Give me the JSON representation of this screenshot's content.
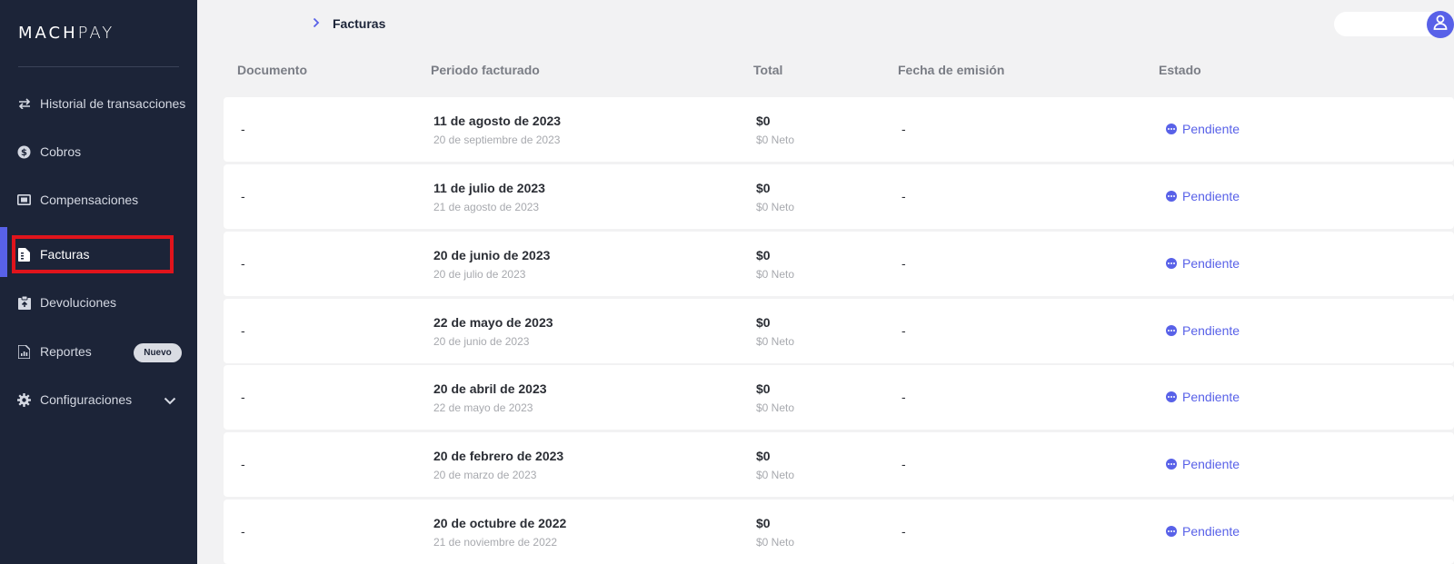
{
  "app": {
    "logo_bold": "MACH",
    "logo_light": "PAY"
  },
  "sidebar": {
    "items": [
      {
        "label": "Historial de transacciones",
        "icon": "arrows-swap-icon"
      },
      {
        "label": "Cobros",
        "icon": "dollar-coin-icon"
      },
      {
        "label": "Compensaciones",
        "icon": "banknote-icon"
      },
      {
        "label": "Facturas",
        "icon": "invoice-icon",
        "active": true
      },
      {
        "label": "Devoluciones",
        "icon": "return-box-icon"
      },
      {
        "label": "Reportes",
        "icon": "report-chart-icon",
        "badge": "Nuevo"
      },
      {
        "label": "Configuraciones",
        "icon": "gear-icon"
      }
    ]
  },
  "header": {
    "breadcrumb": "Facturas"
  },
  "table": {
    "columns": [
      "Documento",
      "Periodo facturado",
      "Total",
      "Fecha de emisión",
      "Estado"
    ],
    "rows": [
      {
        "documento": "-",
        "period_start": "11 de agosto de 2023",
        "period_end": "20 de septiembre de 2023",
        "total": "$0",
        "neto": "$0 Neto",
        "fecha": "-",
        "estado": "Pendiente"
      },
      {
        "documento": "-",
        "period_start": "11 de julio de 2023",
        "period_end": "21 de agosto de 2023",
        "total": "$0",
        "neto": "$0 Neto",
        "fecha": "-",
        "estado": "Pendiente"
      },
      {
        "documento": "-",
        "period_start": "20 de junio de 2023",
        "period_end": "20 de julio de 2023",
        "total": "$0",
        "neto": "$0 Neto",
        "fecha": "-",
        "estado": "Pendiente"
      },
      {
        "documento": "-",
        "period_start": "22 de mayo de 2023",
        "period_end": "20 de junio de 2023",
        "total": "$0",
        "neto": "$0 Neto",
        "fecha": "-",
        "estado": "Pendiente"
      },
      {
        "documento": "-",
        "period_start": "20 de abril de 2023",
        "period_end": "22 de mayo de 2023",
        "total": "$0",
        "neto": "$0 Neto",
        "fecha": "-",
        "estado": "Pendiente"
      },
      {
        "documento": "-",
        "period_start": "20 de febrero de 2023",
        "period_end": "20 de marzo de 2023",
        "total": "$0",
        "neto": "$0 Neto",
        "fecha": "-",
        "estado": "Pendiente"
      },
      {
        "documento": "-",
        "period_start": "20 de octubre de 2022",
        "period_end": "21 de noviembre de 2022",
        "total": "$0",
        "neto": "$0 Neto",
        "fecha": "-",
        "estado": "Pendiente"
      }
    ]
  },
  "colors": {
    "sidebar_bg": "#1c2438",
    "accent": "#5861e8",
    "highlight": "#e0141c"
  }
}
